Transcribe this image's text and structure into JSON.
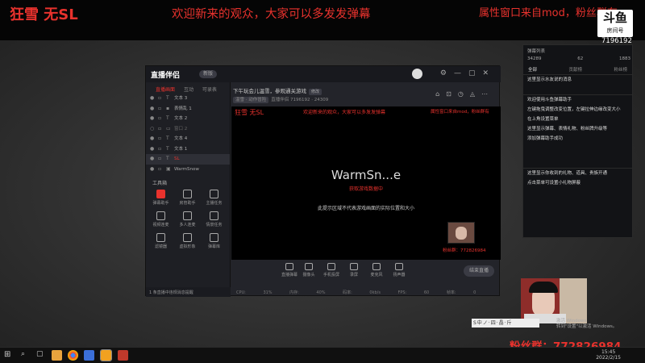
{
  "overlay": {
    "title": "狂雪 无SL",
    "banner": "欢迎新来的观众，大家可以多发发弹幕",
    "notice": "属性窗口来自mod，粉丝群有",
    "logo_text": "斗鱼",
    "logo_sub": "房间号",
    "room_id": "7196192",
    "fans_group": "粉丝群：772826984"
  },
  "app": {
    "logo": "直播伴侣",
    "badge": "新版",
    "side_tabs": [
      "直播画面",
      "互动",
      "可录表"
    ],
    "layers": [
      {
        "label": "文本 3"
      },
      {
        "label": "表情乱 1"
      },
      {
        "label": "文本 2"
      },
      {
        "label": "窗口 2"
      },
      {
        "label": "文本 4"
      },
      {
        "label": "文本 1"
      },
      {
        "label": "SL"
      },
      {
        "label": "WarmSnow"
      }
    ],
    "tools_title": "工具箱",
    "tools": [
      {
        "label": "弹幕助手"
      },
      {
        "label": "房管助手"
      },
      {
        "label": "主播任务"
      },
      {
        "label": "视频连麦"
      },
      {
        "label": "多人连麦"
      },
      {
        "label": "情景任务"
      },
      {
        "label": "滤镜器"
      },
      {
        "label": "虚拟形象"
      },
      {
        "label": "弹幕库"
      }
    ],
    "footer_text": "1 条直播中违规消息提醒",
    "main_title": "下午玩会儿温雪，参观通关游戏",
    "main_tag": "修改",
    "sub_tag": "温雪 · 动作冒险",
    "sub_text": "直播伴侣 7196192 · 24309",
    "preview": {
      "title": "狂雪 无SL",
      "banner": "欢迎新来的观众，大家可以多发发弹幕",
      "notice": "属性窗口来自mod，粉丝群有",
      "game": "WarmSn...e",
      "status": "获取游戏数据中",
      "hint": "此提示区域不代表游戏画面的实际位置和大小",
      "fans": "粉丝群：772826984"
    },
    "toolbar": [
      {
        "label": "直播弹幕"
      },
      {
        "label": "摄像头"
      },
      {
        "label": "手机投屏"
      },
      {
        "label": "录屏"
      },
      {
        "label": "麦克风"
      },
      {
        "label": "扬声器"
      }
    ],
    "go_live": "结束直播",
    "statusbar": "CPU: 31% 内存: 40% 码率: 0kb/s FPS: 60 帧率: 0"
  },
  "chat": {
    "title": "弹幕列表",
    "stats": [
      "34289",
      "62",
      "1883"
    ],
    "tabs": [
      "全部",
      "贡献榜",
      "粉丝榜"
    ],
    "messages": [
      "这里显示水友说的消息",
      "欢迎使用斗鱼弹幕助手",
      "左键拖曳调整改变位置，左键拉伸边缘改变大小",
      "在上角设置菜单",
      "这里显示弹幕、表情礼物、粉丝牌升级等",
      "添加弹幕助手成功",
      "这里显示你收到的礼物、道具、贵族开通",
      "点击菜单可设置小礼物屏蔽"
    ]
  },
  "desktop": {
    "tray_text": "S中ノ·四·晶·斤",
    "activate": "激活 Windows",
    "activate_sub": "转到\"设置\"以激活 Windows。",
    "time": "15:45",
    "date": "2022/2/15"
  }
}
